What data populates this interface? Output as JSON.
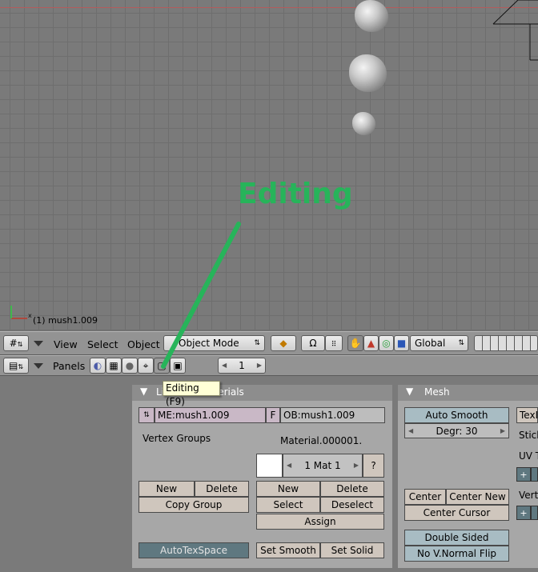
{
  "viewport": {
    "object_label": "(1) mush1.009",
    "annotation": "Editing"
  },
  "header": {
    "menus": [
      "View",
      "Select",
      "Object"
    ],
    "mode": "Object Mode",
    "orientation": "Global"
  },
  "buttons_header": {
    "panels_label": "Panels",
    "frame_value": "1"
  },
  "tooltip": "Editing (F9)",
  "link_panel": {
    "title": "Link and Materials",
    "me_name": "ME:mush1.009",
    "f_label": "F",
    "ob_name": "OB:mush1.009",
    "vertex_groups_label": "Vertex Groups",
    "material_name": "Material.000001.",
    "mat_index": "1 Mat 1",
    "question": "?",
    "new_vg": "New",
    "delete_vg": "Delete",
    "copy_group": "Copy Group",
    "new_mat": "New",
    "delete_mat": "Delete",
    "select": "Select",
    "deselect": "Deselect",
    "assign": "Assign",
    "autotexspace": "AutoTexSpace",
    "set_smooth": "Set Smooth",
    "set_solid": "Set Solid"
  },
  "mesh_panel": {
    "title": "Mesh",
    "auto_smooth": "Auto Smooth",
    "degr": "Degr: 30",
    "center": "Center",
    "center_new": "Center New",
    "center_cursor": "Center Cursor",
    "double_sided": "Double Sided",
    "no_vnormal_flip": "No V.Normal Flip",
    "texmesh": "TexM",
    "sticky": "Stick",
    "uv": "UV T",
    "vert": "Vert"
  }
}
